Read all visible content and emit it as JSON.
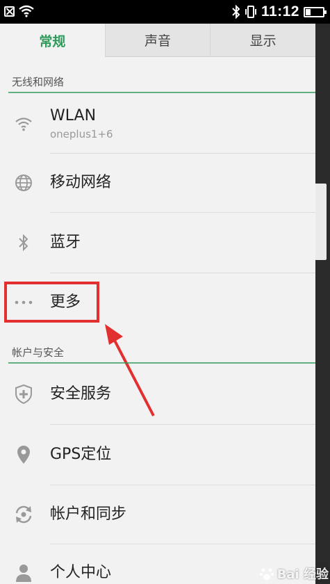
{
  "status_bar": {
    "time": "11:12",
    "battery_level": 0.3,
    "icons": [
      "notification-icon",
      "wifi-icon",
      "bluetooth-icon",
      "vibrate-icon",
      "battery-icon"
    ]
  },
  "tabs": [
    {
      "label": "常规",
      "active": true
    },
    {
      "label": "声音",
      "active": false
    },
    {
      "label": "显示",
      "active": false
    }
  ],
  "sections": {
    "wireless": {
      "title": "无线和网络"
    },
    "account": {
      "title": "帐户与安全"
    }
  },
  "items": {
    "wlan": {
      "label": "WLAN",
      "sub": "oneplus1+6",
      "icon": "wifi-icon"
    },
    "mobile": {
      "label": "移动网络",
      "icon": "globe-icon"
    },
    "bluetooth": {
      "label": "蓝牙",
      "icon": "bluetooth-icon"
    },
    "more": {
      "label": "更多",
      "icon": "more-dots-icon"
    },
    "security": {
      "label": "安全服务",
      "icon": "shield-plus-icon"
    },
    "gps": {
      "label": "GPS定位",
      "icon": "location-pin-icon"
    },
    "sync": {
      "label": "帐户和同步",
      "icon": "sync-icon"
    },
    "personal": {
      "label": "个人中心",
      "icon": "person-icon"
    }
  },
  "colors": {
    "accent": "#2e9b5a",
    "highlight": "#e23030"
  },
  "watermark": {
    "text": "Bai 经验"
  }
}
